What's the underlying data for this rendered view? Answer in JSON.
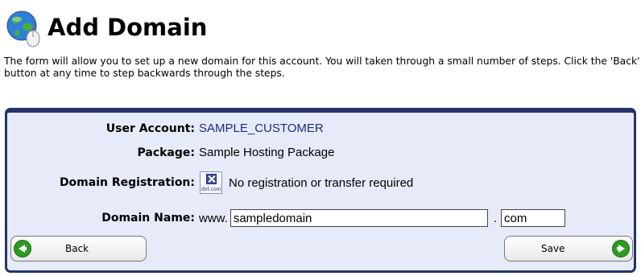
{
  "header": {
    "title": "Add Domain",
    "icon": "globe-mouse-icon"
  },
  "description": "The form will allow you to set up a new domain for this account. You will taken through a small number of steps. Click the 'Back' button at any time to step backwards through the steps.",
  "form": {
    "user_account_label": "User Account:",
    "user_account_value": "SAMPLE_CUSTOMER",
    "package_label": "Package:",
    "package_value": "Sample Hosting Package",
    "domain_registration_label": "Domain Registration:",
    "domain_registration_icon_text": "dot.com",
    "domain_registration_value": "No registration or transfer required",
    "domain_name_label": "Domain Name:",
    "domain_prefix": "www.",
    "domain_name_value": "sampledomain",
    "domain_separator": ".",
    "tld_value": "com"
  },
  "buttons": {
    "back_label": "Back",
    "save_label": "Save"
  },
  "colors": {
    "panel_border": "#25336a",
    "panel_background": "#e7eaf9",
    "accent_text": "#1a2d7c",
    "arrow_green": "#2f9a20"
  }
}
